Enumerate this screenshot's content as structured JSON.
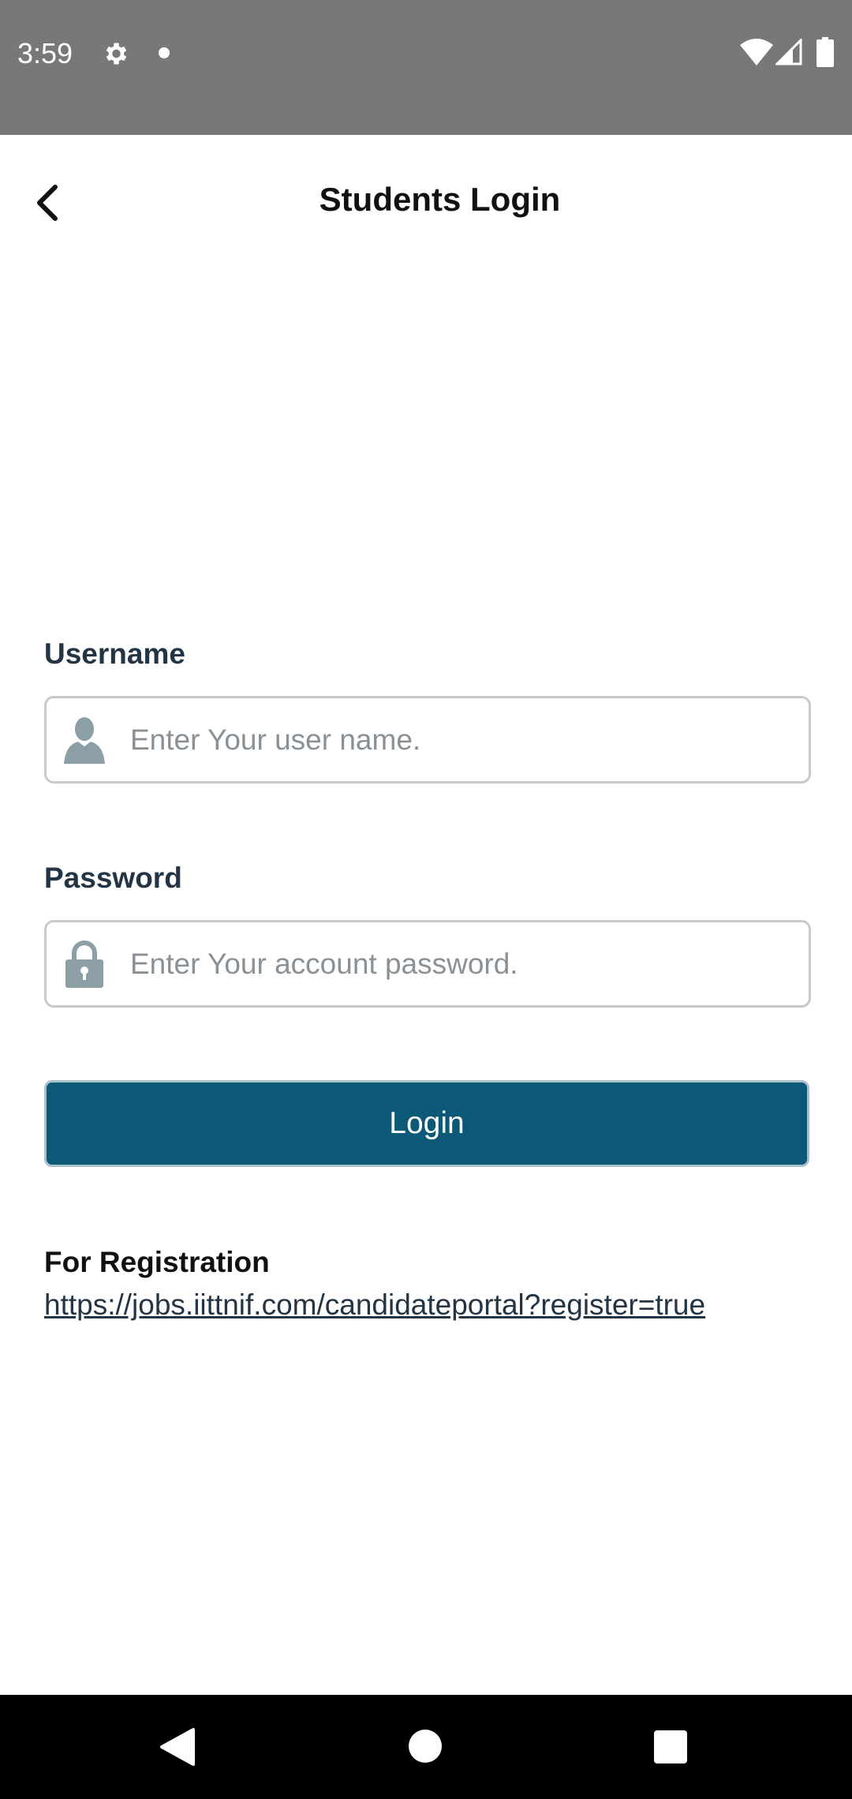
{
  "status_bar": {
    "time": "3:59",
    "icons": [
      "gear-icon",
      "dot-icon",
      "wifi-icon",
      "signal-icon",
      "battery-icon"
    ]
  },
  "header": {
    "title": "Students Login",
    "back_icon": "chevron-left-icon"
  },
  "form": {
    "username": {
      "label": "Username",
      "placeholder": "Enter Your user name.",
      "value": "",
      "icon": "user-icon"
    },
    "password": {
      "label": "Password",
      "placeholder": "Enter Your account password.",
      "value": "",
      "icon": "lock-icon"
    },
    "login_label": "Login"
  },
  "registration": {
    "label": "For Registration",
    "link": "https://jobs.iittnif.com/candidateportal?register=true"
  },
  "nav_bar": {
    "icons": [
      "nav-back-icon",
      "nav-home-icon",
      "nav-recents-icon"
    ]
  },
  "colors": {
    "status_bar_bg": "#787878",
    "primary_button": "#0b5877",
    "label_text": "#233444",
    "input_border": "#c9c9c9",
    "icon_gray": "#8c9ea6"
  }
}
